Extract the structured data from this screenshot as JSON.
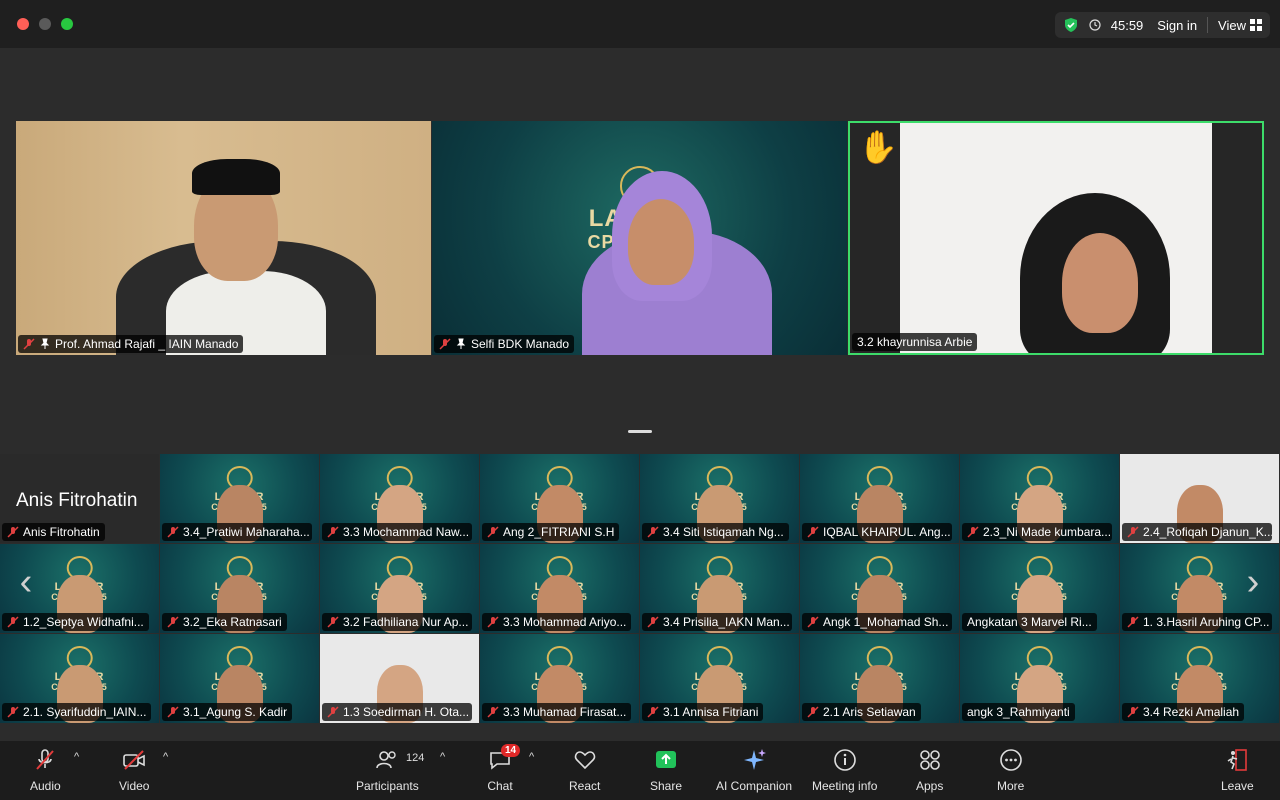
{
  "timer": "45:59",
  "sign_in": "Sign in",
  "view": "View",
  "speakers": [
    {
      "name": "Prof. Ahmad Rajafi _ IAIN Manado"
    },
    {
      "name": "Selfi BDK Manado"
    },
    {
      "name": "3.2 khayrunnisa Arbie"
    }
  ],
  "featured_name": "Anis Fitrohatin",
  "tiles": [
    "Anis Fitrohatin",
    "3.4_Pratiwi Maharaha...",
    "3.3 Mochammad Naw...",
    "Ang 2_FITRIANI S.H",
    "3.4 Siti Istiqamah Ng...",
    "IQBAL KHAIRUL. Ang...",
    "2.3_Ni Made kumbara...",
    "2.4_Rofiqah Djanun_K...",
    "1.2_Septya Widhafni...",
    "3.2_Eka Ratnasari",
    "3.2 Fadhiliana Nur Ap...",
    "3.3 Mohammad Ariyo...",
    "3.4 Prisilia_IAKN Man...",
    "Angk 1_Mohamad Sh...",
    "Angkatan 3 Marvel Ri...",
    "1. 3.Hasril Aruhing CP...",
    "2.1. Syarifuddin_IAIN...",
    "3.1_Agung S. Kadir",
    "1.3 Soedirman H. Ota...",
    "3.3 Muhamad Firasat...",
    "3.1 Annisa Fitriani",
    "2.1 Aris Setiawan",
    "angk 3_Rahmiyanti",
    "3.4 Rezki Amaliah"
  ],
  "logo_text": [
    "LATSAR",
    "CPNS 2025"
  ],
  "toolbar": {
    "audio": "Audio",
    "video": "Video",
    "participants": "Participants",
    "participants_count": "124",
    "chat": "Chat",
    "chat_badge": "14",
    "react": "React",
    "share": "Share",
    "ai": "AI Companion",
    "info": "Meeting info",
    "apps": "Apps",
    "more": "More",
    "leave": "Leave"
  }
}
